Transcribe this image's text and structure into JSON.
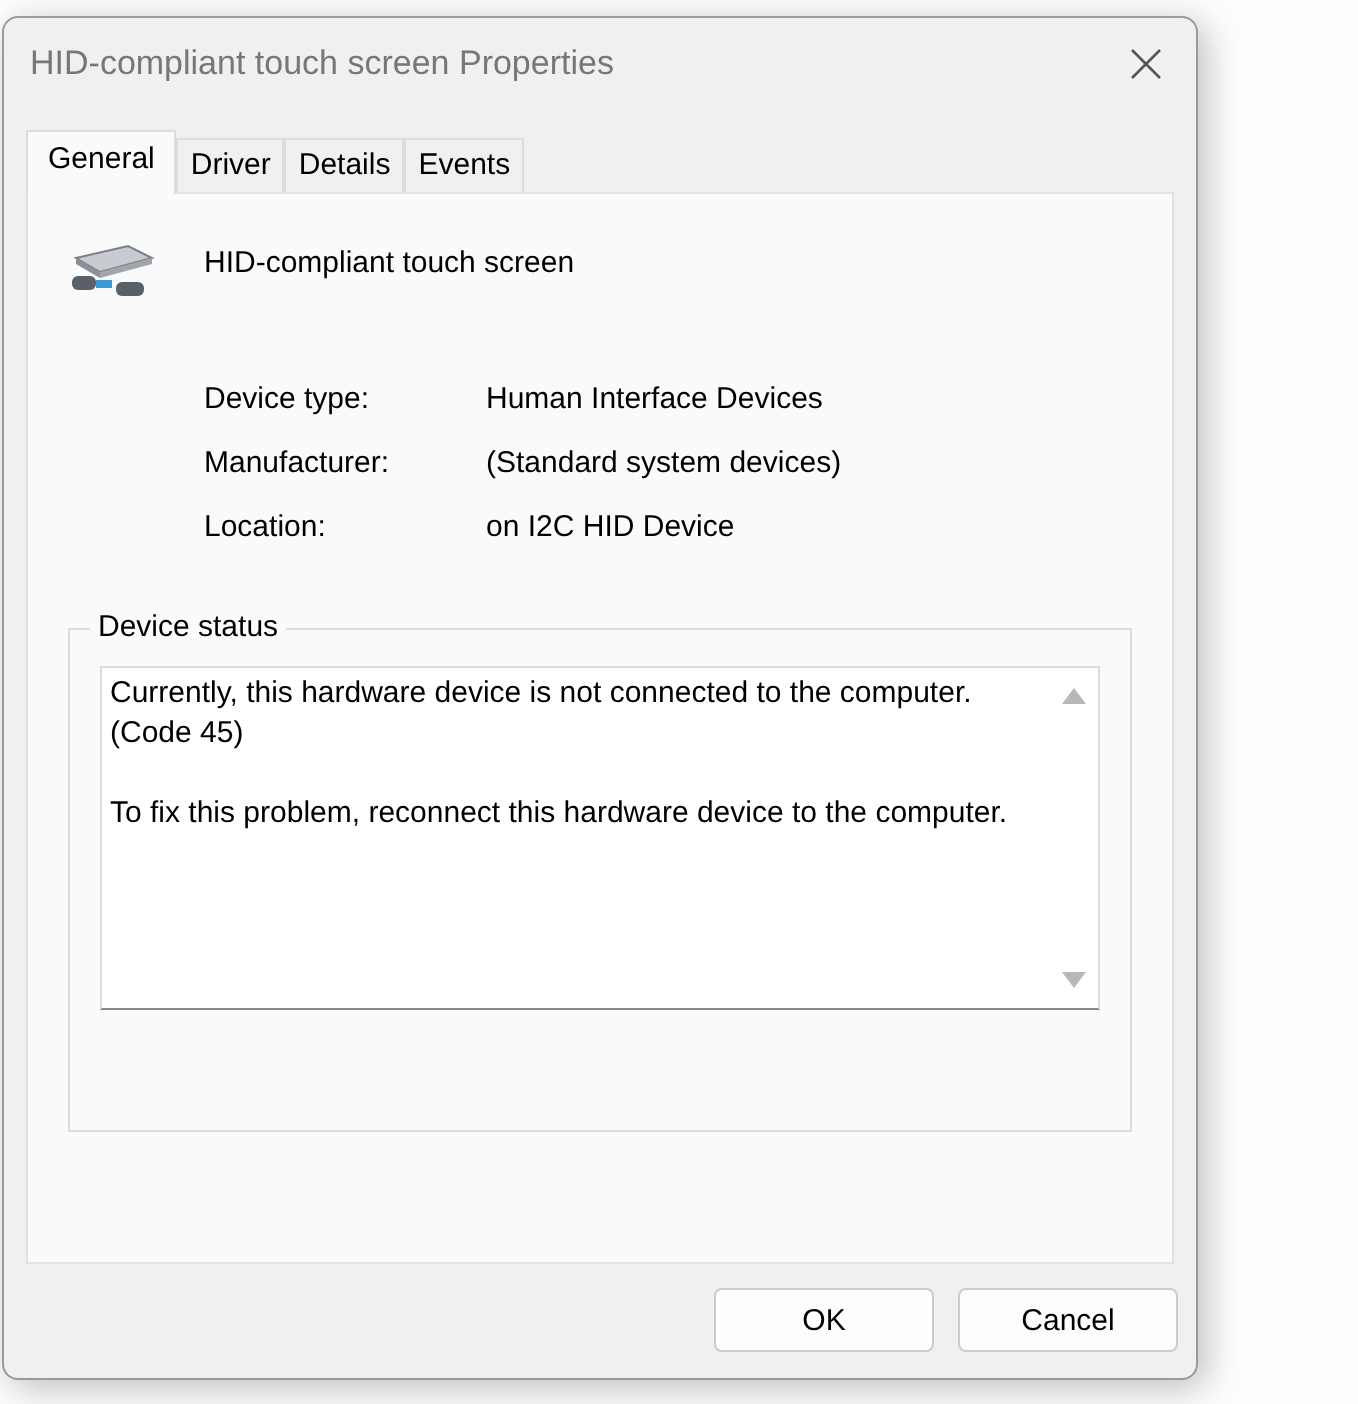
{
  "window": {
    "title": "HID-compliant touch screen Properties"
  },
  "tabs": [
    {
      "label": "General",
      "selected": true
    },
    {
      "label": "Driver",
      "selected": false
    },
    {
      "label": "Details",
      "selected": false
    },
    {
      "label": "Events",
      "selected": false
    }
  ],
  "device": {
    "name": "HID-compliant touch screen"
  },
  "properties": [
    {
      "label": "Device type:",
      "value": "Human Interface Devices"
    },
    {
      "label": "Manufacturer:",
      "value": "(Standard system devices)"
    },
    {
      "label": "Location:",
      "value": "on I2C HID Device"
    }
  ],
  "device_status": {
    "title": "Device status",
    "paragraphs": [
      "Currently, this hardware device is not connected to the computer. (Code 45)",
      "To fix this problem, reconnect this hardware device to the computer."
    ]
  },
  "buttons": [
    "OK",
    "Cancel"
  ]
}
